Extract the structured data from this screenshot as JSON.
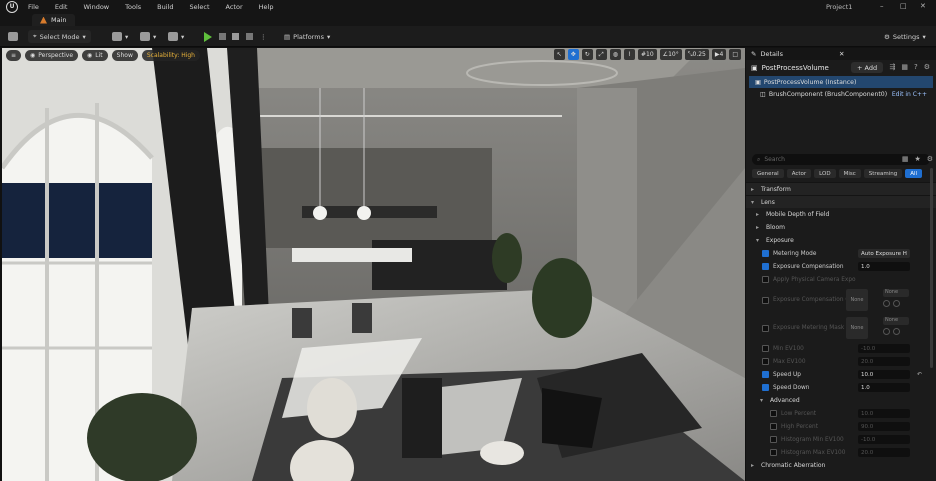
{
  "menu": [
    "File",
    "Edit",
    "Window",
    "Tools",
    "Build",
    "Select",
    "Actor",
    "Help"
  ],
  "project_name": "Project1",
  "level_tab": "Main",
  "toolbar": {
    "select_mode": "Select Mode",
    "platforms": "Platforms",
    "settings": "Settings"
  },
  "viewport": {
    "perspective": "Perspective",
    "lit": "Lit",
    "show": "Show",
    "scalability": "Scalability: High",
    "grid_snap": "10",
    "rotation_snap": "10°",
    "scale_snap": "0.25",
    "camera_speed": "4"
  },
  "details": {
    "tab": "Details",
    "actor_name": "PostProcessVolume",
    "add_label": "+ Add",
    "components": [
      {
        "label": "PostProcessVolume (Instance)"
      },
      {
        "label": "BrushComponent (BrushComponent0)"
      }
    ],
    "edit_cpp": "Edit in C++",
    "search_placeholder": "Search",
    "filters": [
      "General",
      "Actor",
      "LOD",
      "Misc",
      "Streaming",
      "All"
    ],
    "sections": {
      "transform": "Transform",
      "lens": "Lens",
      "mobile_dof": "Mobile Depth of Field",
      "bloom": "Bloom",
      "exposure": "Exposure",
      "advanced": "Advanced",
      "chromatic": "Chromatic Aberration"
    },
    "props": {
      "metering_mode": "Metering Mode",
      "metering_mode_value": "Auto Exposure H",
      "exposure_comp": "Exposure Compensation",
      "exposure_comp_value": "1.0",
      "apply_phys": "Apply Physical Camera Expo",
      "exp_comp_curve": "Exposure Compensation Cur",
      "exp_meter_mask": "Exposure Metering Mask",
      "min_ev": "Min EV100",
      "min_ev_value": "-10.0",
      "max_ev": "Max EV100",
      "max_ev_value": "20.0",
      "speed_up": "Speed Up",
      "speed_up_value": "10.0",
      "speed_down": "Speed Down",
      "speed_down_value": "1.0",
      "low_percent": "Low Percent",
      "low_percent_value": "10.0",
      "high_percent": "High Percent",
      "high_percent_value": "90.0",
      "hist_min": "Histogram Min EV100",
      "hist_min_value": "-10.0",
      "hist_max": "Histogram Max EV100",
      "hist_max_value": "20.0",
      "none_label": "None"
    }
  }
}
